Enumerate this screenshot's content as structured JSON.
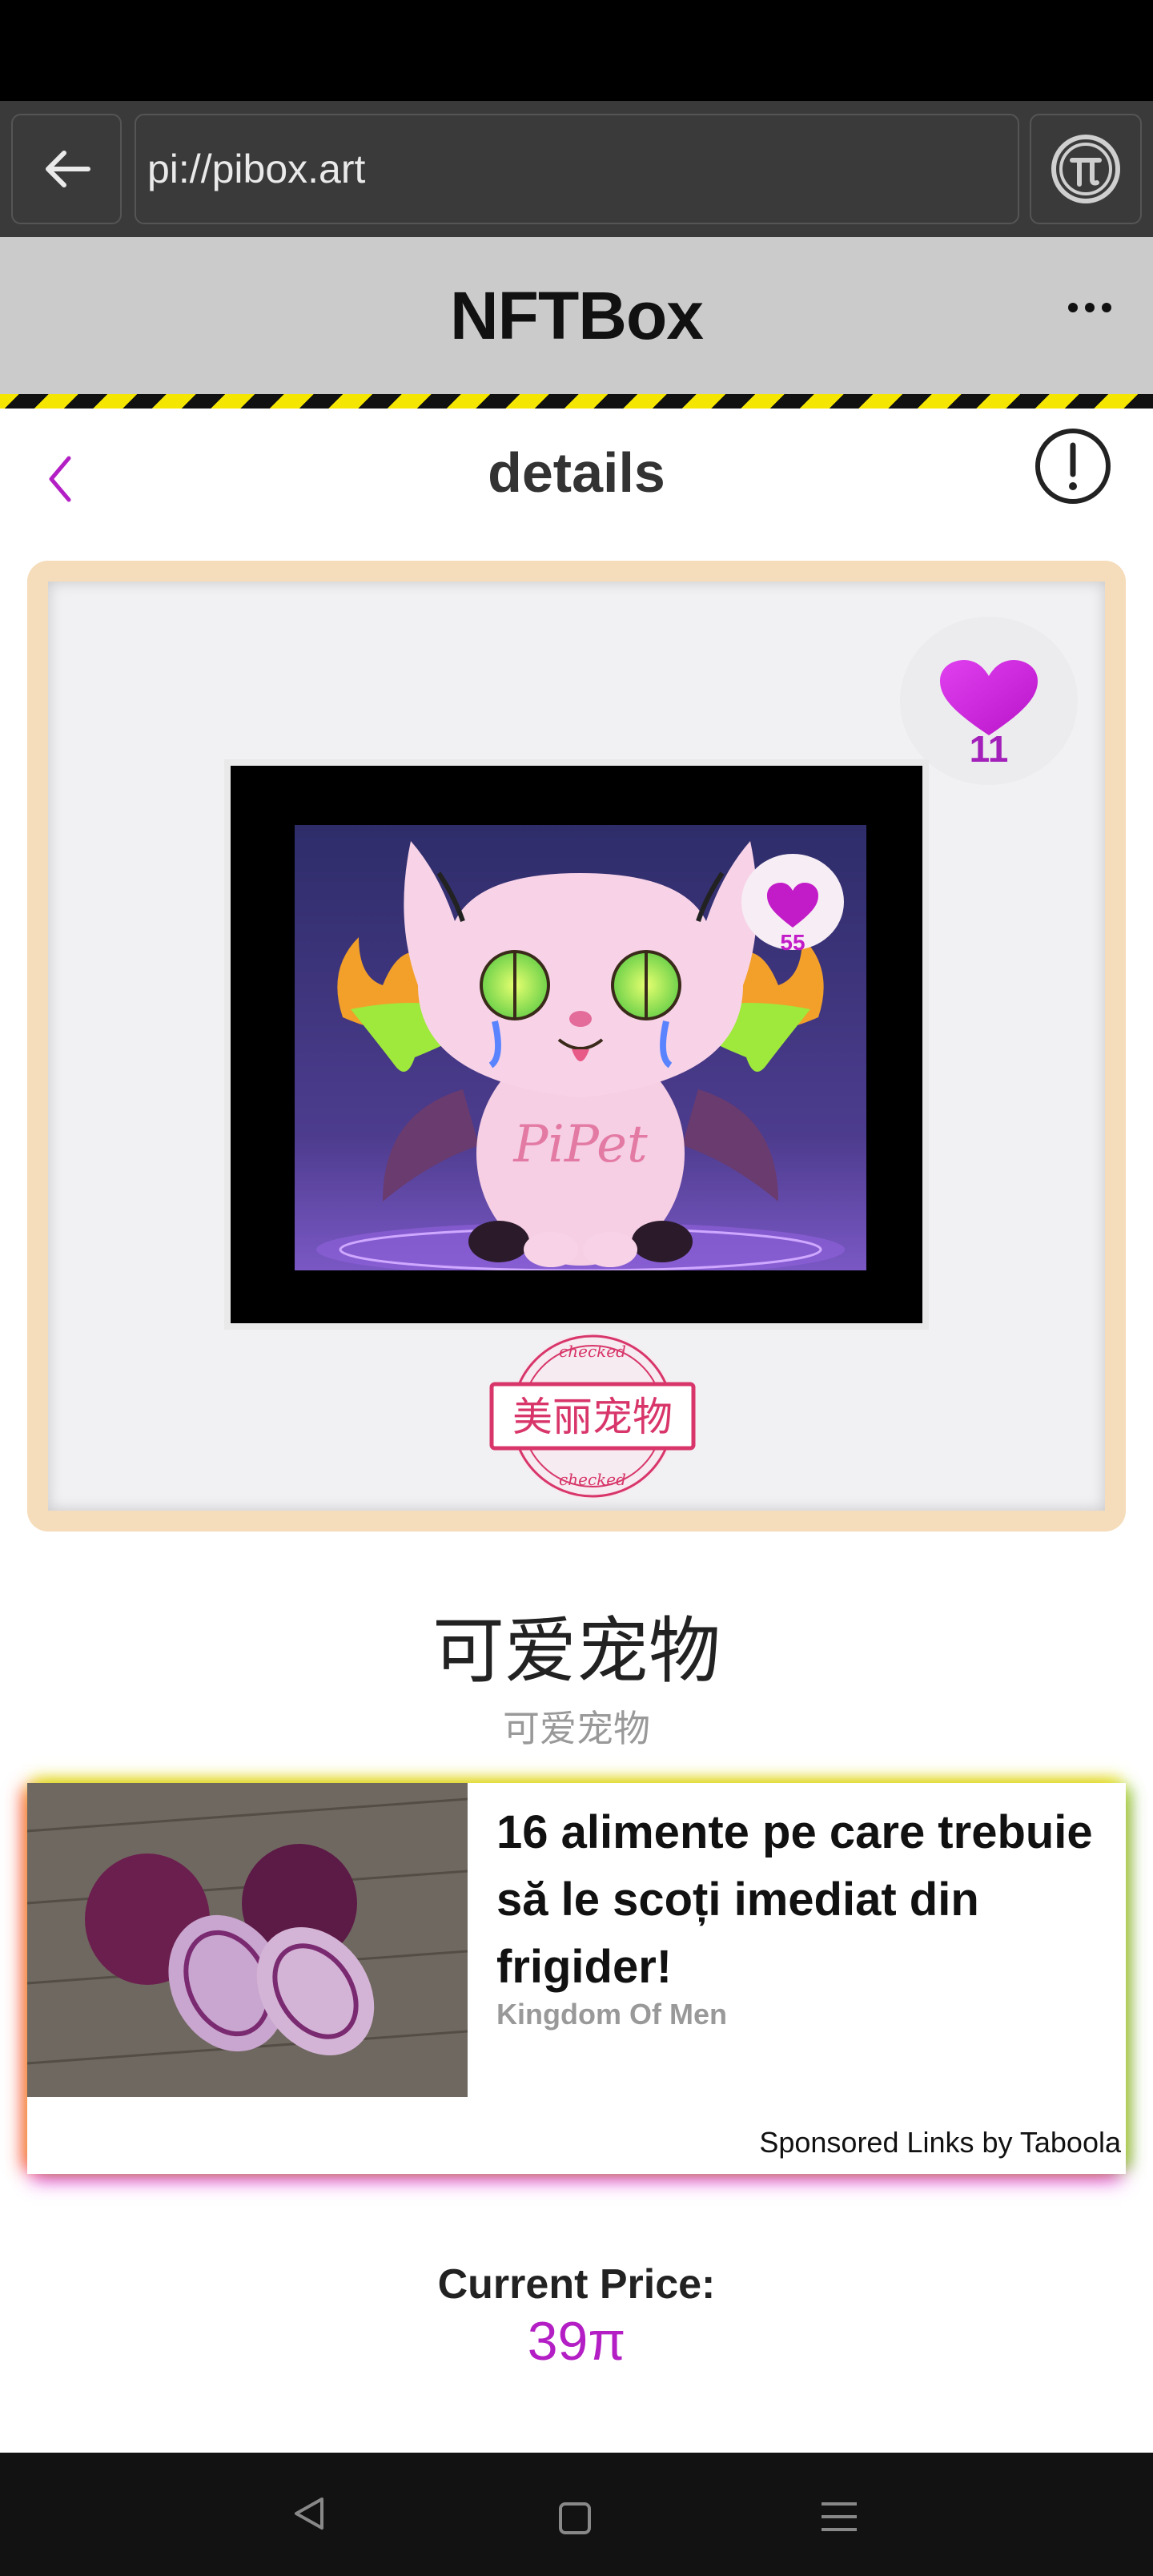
{
  "browser": {
    "url": "pi://pibox.art"
  },
  "app": {
    "title": "NFTBox"
  },
  "page": {
    "title": "details"
  },
  "nft": {
    "likes": "11",
    "image_likes": "55",
    "stamp_text": "美丽宠物",
    "stamp_ring_text": "checked",
    "art_text": "PiPet",
    "title": "可爱宠物",
    "subtitle": "可爱宠物"
  },
  "ad": {
    "headline": "16 alimente pe care trebuie să le scoți imediat din frigider!",
    "source": "Kingdom Of Men",
    "sponsor": "Sponsored Links by Taboola"
  },
  "price": {
    "label": "Current Price:",
    "value": "39π"
  },
  "colors": {
    "accent": "#b31fc4",
    "heart": "#d020d8",
    "header_bg": "#cbcbcb",
    "browser_bg": "#3a3a3a",
    "hazard_yellow": "#f4e600",
    "frame_wood": "#f5dcba",
    "stamp_red": "#d8366a"
  },
  "icons": {
    "browser_back": "arrow-left-icon",
    "pi": "pi-coin-icon",
    "more": "more-dots-icon",
    "page_back": "chevron-left-icon",
    "info": "info-exclamation-icon",
    "like": "heart-icon",
    "nav_back": "triangle-back-icon",
    "nav_home": "square-home-icon",
    "nav_menu": "menu-lines-icon"
  }
}
